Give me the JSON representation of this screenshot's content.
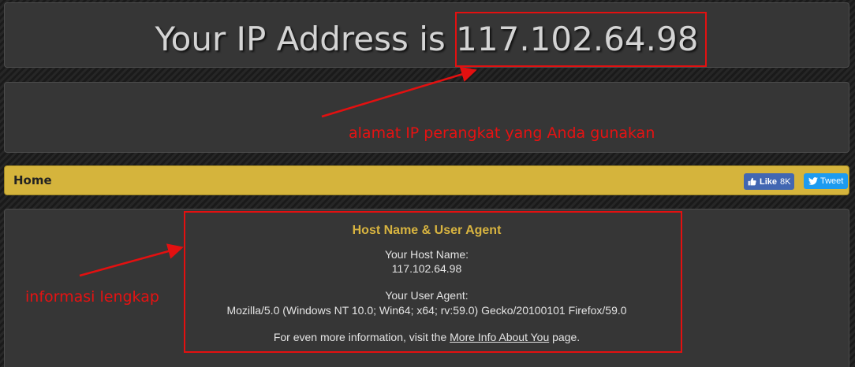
{
  "header": {
    "prefix": "Your IP Address is",
    "ip": "117.102.64.98"
  },
  "nav": {
    "home_label": "Home",
    "fb_like_label": "Like",
    "fb_like_count": "8K",
    "tweet_label": "Tweet"
  },
  "info": {
    "heading": "Host Name & User Agent",
    "host_label": "Your Host Name:",
    "host_value": "117.102.64.98",
    "ua_label": "Your User Agent:",
    "ua_value": "Mozilla/5.0 (Windows NT 10.0; Win64; x64; rv:59.0) Gecko/20100101 Firefox/59.0",
    "more_prefix": "For even more information, visit the",
    "more_link": "More Info About You",
    "more_suffix": "page."
  },
  "annotations": {
    "ip_note": "alamat IP perangkat yang Anda gunakan",
    "info_note": "informasi lengkap",
    "color": "#e31010"
  },
  "colors": {
    "nav_bar": "#d5b43c",
    "heading_gold": "#d8b440",
    "facebook": "#4267b2",
    "twitter": "#1d9bf0"
  }
}
